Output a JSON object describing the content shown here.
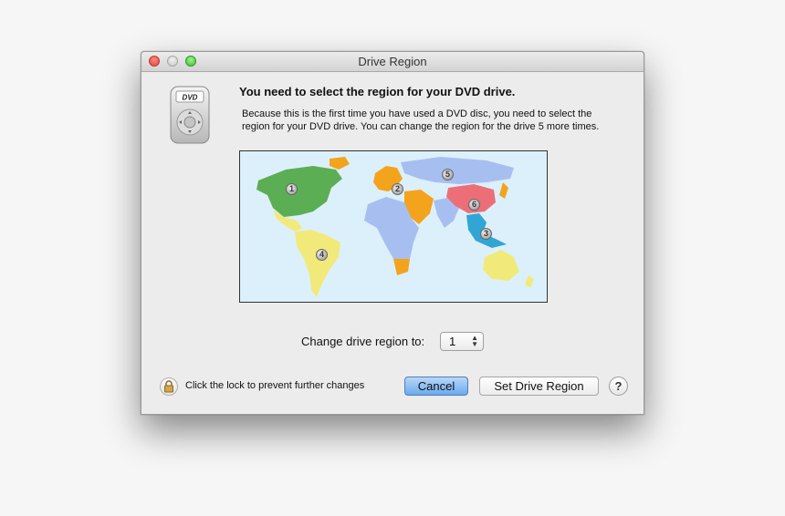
{
  "window": {
    "title": "Drive Region"
  },
  "header": {
    "heading": "You need to select the region for your DVD drive.",
    "description": "Because this is the first time you have used a DVD disc, you need to select the region for your DVD drive. You can change the region for the drive 5 more times.",
    "icon": "dvd-player-icon",
    "icon_label": "DVD"
  },
  "map": {
    "region_badges": [
      "1",
      "2",
      "3",
      "4",
      "5",
      "6"
    ],
    "region_colors": {
      "1": "#5cae54",
      "2": "#f3a31c",
      "3": "#31a6d4",
      "4": "#f1ea7a",
      "5": "#a7bff0",
      "6": "#ec6f77"
    }
  },
  "region_picker": {
    "label": "Change drive region to:",
    "selected": "1"
  },
  "footer": {
    "lock_text": "Click the lock to prevent further changes",
    "cancel_label": "Cancel",
    "set_label": "Set Drive Region",
    "help_label": "?"
  }
}
